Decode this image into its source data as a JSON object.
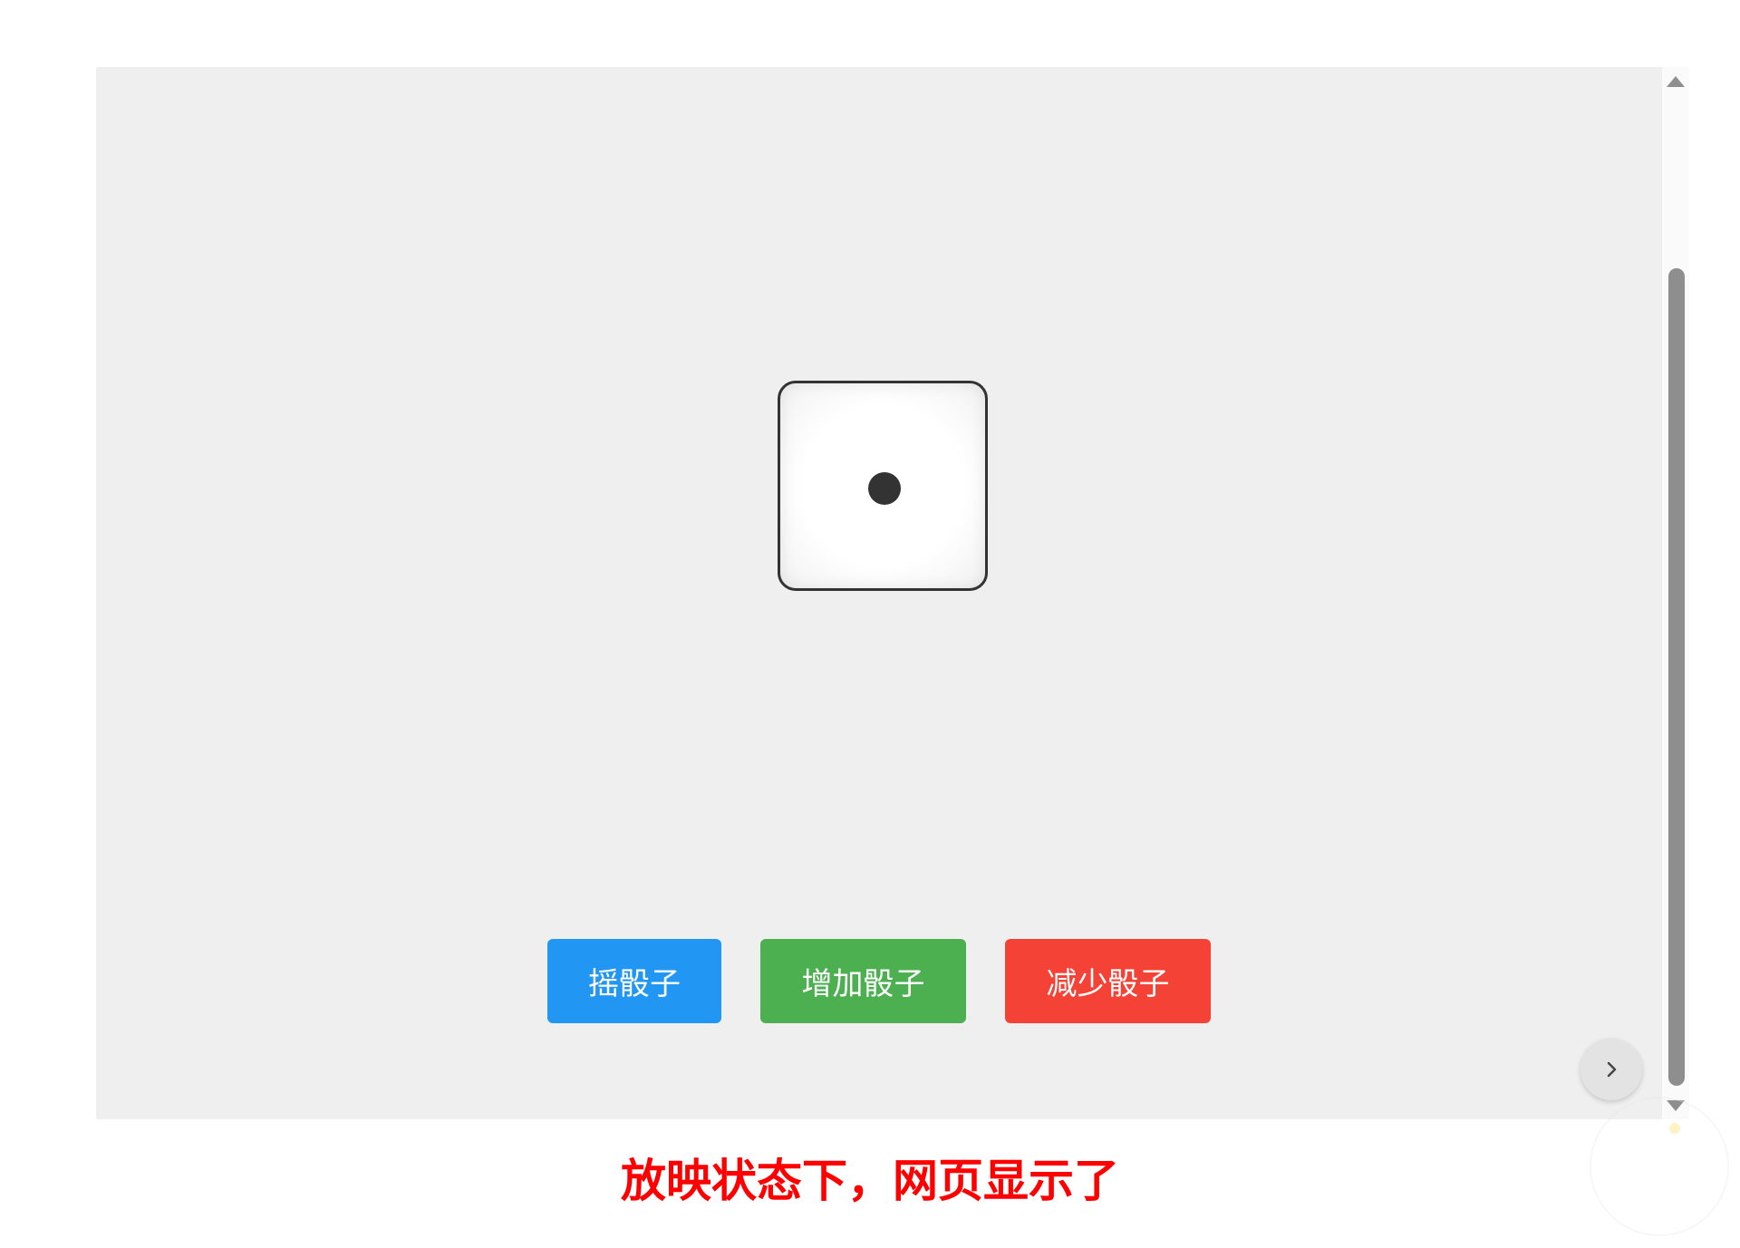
{
  "dice": {
    "count": 1,
    "face_value": 1
  },
  "controls": {
    "roll_label": "摇骰子",
    "add_label": "增加骰子",
    "remove_label": "减少骰子"
  },
  "icons": {
    "next": "chevron-right-icon"
  },
  "caption": {
    "text": "放映状态下，网页显示了"
  },
  "colors": {
    "roll_button": "#2196f3",
    "add_button": "#4caf50",
    "remove_button": "#f44336",
    "caption": "#ff0000",
    "frame_background": "#efefef"
  }
}
